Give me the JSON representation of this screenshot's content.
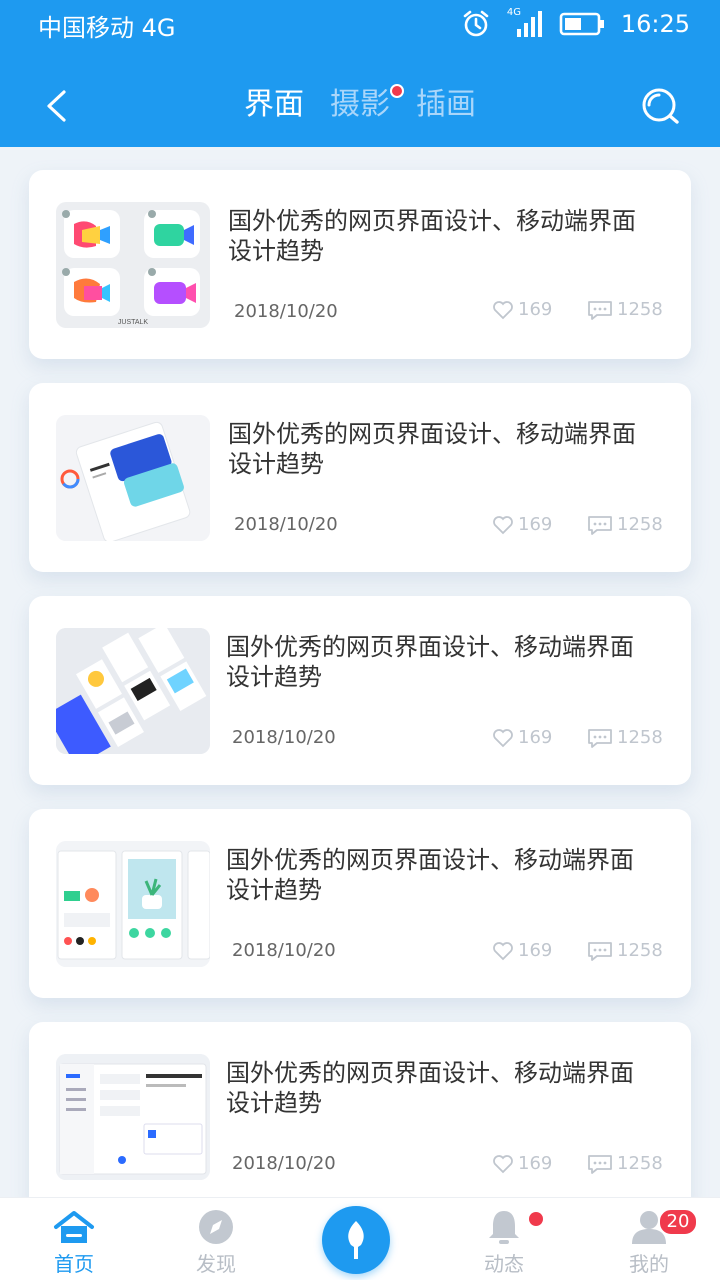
{
  "status_bar": {
    "carrier": "中国移动 4G",
    "signal_label": "4G",
    "time": "16:25"
  },
  "nav": {
    "tabs": [
      {
        "label": "界面",
        "active": true
      },
      {
        "label": "摄影",
        "active": false,
        "dot": true
      },
      {
        "label": "插画",
        "active": false
      }
    ]
  },
  "articles": [
    {
      "title": "国外优秀的网页界面设计、移动端界面设计趋势",
      "date": "2018/10/20",
      "likes": "169",
      "comments": "1258",
      "thumb": "video-app-icons",
      "thumb_caption": "JUSTALK"
    },
    {
      "title": "国外优秀的网页界面设计、移动端界面设计趋势",
      "date": "2018/10/20",
      "likes": "169",
      "comments": "1258",
      "thumb": "wallet-cards"
    },
    {
      "title": "国外优秀的网页界面设计、移动端界面设计趋势",
      "date": "2018/10/20",
      "likes": "169",
      "comments": "1258",
      "thumb": "ui-collage"
    },
    {
      "title": "国外优秀的网页界面设计、移动端界面设计趋势",
      "date": "2018/10/20",
      "likes": "169",
      "comments": "1258",
      "thumb": "mobile-screens"
    },
    {
      "title": "国外优秀的网页界面设计、移动端界面设计趋势",
      "date": "2018/10/20",
      "likes": "169",
      "comments": "1258",
      "thumb": "dashboard-web"
    }
  ],
  "bottom_nav": {
    "home": "首页",
    "discover": "发现",
    "activity": "动态",
    "mine": "我的",
    "mine_badge": "20"
  },
  "colors": {
    "primary": "#1e9af0",
    "badge": "#f03a4c",
    "tab_inactive": "#a9d6fa",
    "meta_gray": "#c0c6ce"
  }
}
